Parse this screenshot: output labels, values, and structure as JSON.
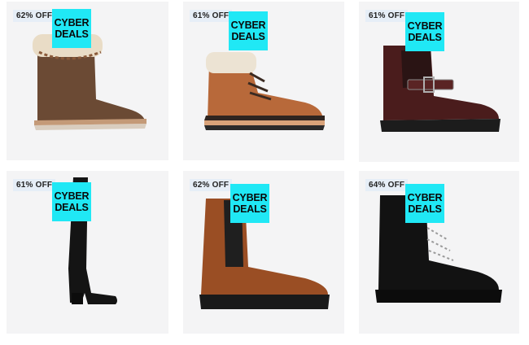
{
  "products": [
    {
      "discount": "62% OFF",
      "badge_line1": "CYBER",
      "badge_line2": "DEALS",
      "item": "shearling-cuff-ankle-boot"
    },
    {
      "discount": "61% OFF",
      "badge_line1": "CYBER",
      "badge_line2": "DEALS",
      "item": "lace-up-hiker-boot"
    },
    {
      "discount": "61% OFF",
      "badge_line1": "CYBER",
      "badge_line2": "DEALS",
      "item": "buckle-chelsea-boot"
    },
    {
      "discount": "61% OFF",
      "badge_line1": "CYBER",
      "badge_line2": "DEALS",
      "item": "knee-high-heeled-boot"
    },
    {
      "discount": "62% OFF",
      "badge_line1": "CYBER",
      "badge_line2": "DEALS",
      "item": "tan-chelsea-boot"
    },
    {
      "discount": "64% OFF",
      "badge_line1": "CYBER",
      "badge_line2": "DEALS",
      "item": "black-lace-up-boot"
    }
  ],
  "colors": {
    "card_bg": "#f4f4f5",
    "badge_bg": "#20e8f5",
    "discount_bg": "#e6eef7"
  }
}
